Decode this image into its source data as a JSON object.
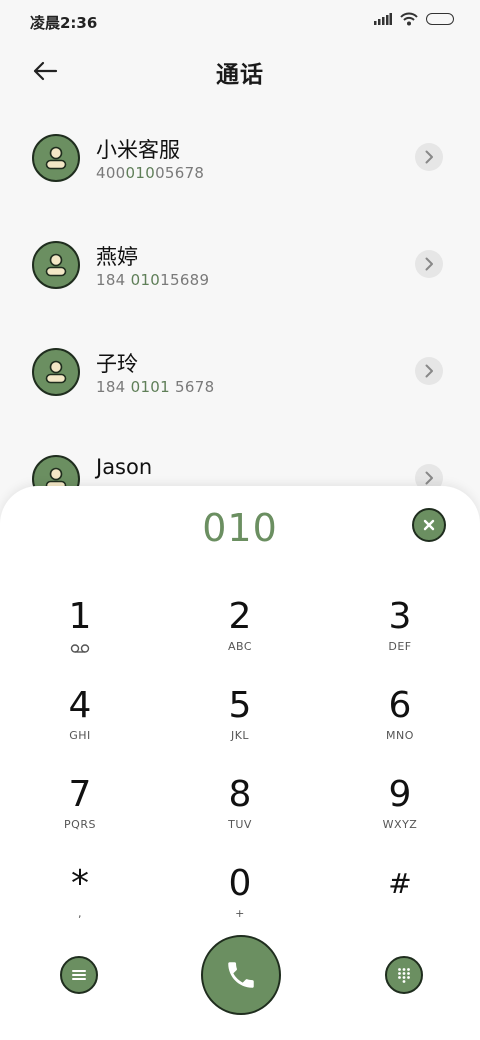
{
  "status_bar": {
    "time": "凌晨2:36",
    "icons": [
      "signal-icon",
      "wifi-icon",
      "battery-icon"
    ]
  },
  "header": {
    "title": "通话",
    "back_icon": "back-arrow-icon"
  },
  "contacts": [
    {
      "name": "小米客服",
      "number_pre": "400",
      "number_match": "010",
      "number_post": "05678"
    },
    {
      "name": "燕婷",
      "number_pre": "184 ",
      "number_match": "010",
      "number_post": "15689"
    },
    {
      "name": "子玲",
      "number_pre": "184 ",
      "number_match": "0101",
      "number_post": " 5678"
    },
    {
      "name": "Jason",
      "number_pre": "",
      "number_match": "",
      "number_post": ""
    }
  ],
  "dialer": {
    "input": "010",
    "keys": [
      {
        "digit": "1",
        "letters": ""
      },
      {
        "digit": "2",
        "letters": "ABC"
      },
      {
        "digit": "3",
        "letters": "DEF"
      },
      {
        "digit": "4",
        "letters": "GHI"
      },
      {
        "digit": "5",
        "letters": "JKL"
      },
      {
        "digit": "6",
        "letters": "MNO"
      },
      {
        "digit": "7",
        "letters": "PQRS"
      },
      {
        "digit": "8",
        "letters": "TUV"
      },
      {
        "digit": "9",
        "letters": "WXYZ"
      },
      {
        "digit": "*",
        "letters": ","
      },
      {
        "digit": "0",
        "letters": "+"
      },
      {
        "digit": "#",
        "letters": ""
      }
    ]
  },
  "colors": {
    "accent": "#6b8f61",
    "outline": "#1f2d1e",
    "panel": "#ffffff",
    "background": "#f7f7f7"
  }
}
